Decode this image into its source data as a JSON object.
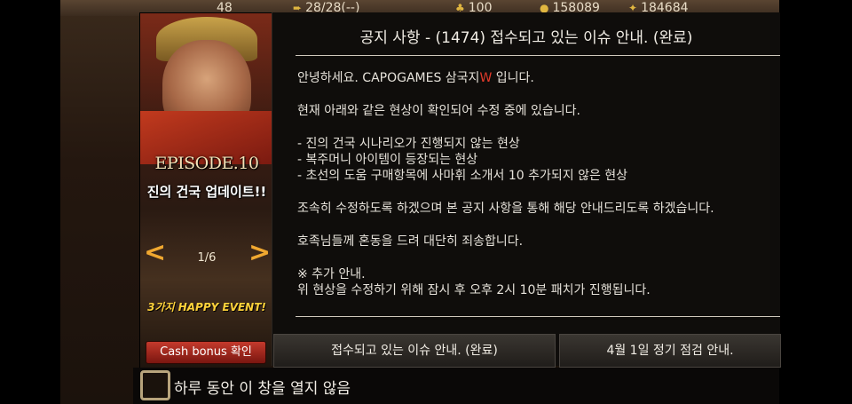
{
  "topbar": {
    "stats": [
      {
        "icon": "level-icon",
        "value": "48"
      },
      {
        "icon": "stamina-arrow-icon",
        "value": "28/28(--)"
      },
      {
        "icon": "troops-icon",
        "value": "100"
      },
      {
        "icon": "gold-icon",
        "value": "158089"
      },
      {
        "icon": "food-icon",
        "value": "184684"
      }
    ]
  },
  "banner": {
    "episode": "EPISODE.10",
    "headline": "진의 건국 업데이트!!",
    "pager": "1/6",
    "event": "3가지 HAPPY EVENT!",
    "cash_button": "Cash bonus 확인"
  },
  "notice": {
    "title": "공지 사항 - (1474) 접수되고 있는 이슈 안내. (완료)",
    "greeting_prefix": "안녕하세요. CAPOGAMES 삼국지",
    "greeting_accent": "W",
    "greeting_suffix": " 입니다.",
    "intro": "현재 아래와 같은 현상이 확인되어 수정 중에 있습니다.",
    "issues": [
      "- 진의 건국 시나리오가 진행되지 않는 현상",
      "- 복주머니 아이템이 등장되는 현상",
      "- 초선의 도움 구매항목에 사마휘 소개서 10 추가되지 않은 현상"
    ],
    "fix_msg": "조속히 수정하도록 하겠으며 본 공지 사항을 통해 해당 안내드리도록 하겠습니다.",
    "apology": "호족님들께 혼동을 드려 대단히 죄송합니다.",
    "extra_heading": "※ 추가 안내.",
    "extra_text": "위 현상을 수정하기 위해 잠시 후 오후 2시 10분 패치가 진행됩니다."
  },
  "tabs": [
    {
      "label": "접수되고 있는 이슈 안내. (완료)"
    },
    {
      "label": "4월 1일 정기 점검 안내."
    }
  ],
  "footer": {
    "dont_show_label": "하루 동안 이 창을 열지 않음"
  }
}
